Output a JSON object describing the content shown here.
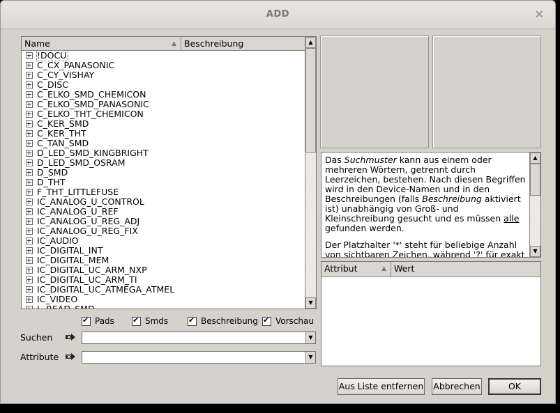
{
  "window": {
    "title": "ADD",
    "close_icon": "✕"
  },
  "tree": {
    "col_name": "Name",
    "col_desc": "Beschreibung",
    "items": [
      "!DOCU",
      "C_CX_PANASONIC",
      "C_CY_VISHAY",
      "C_DISC",
      "C_ELKO_SMD_CHEMICON",
      "C_ELKO_SMD_PANASONIC",
      "C_ELKO_THT_CHEMICON",
      "C_KER_SMD",
      "C_KER_THT",
      "C_TAN_SMD",
      "D_LED_SMD_KINGBRIGHT",
      "D_LED_SMD_OSRAM",
      "D_SMD",
      "D_THT",
      "F_THT_LITTLEFUSE",
      "IC_ANALOG_U_CONTROL",
      "IC_ANALOG_U_REF",
      "IC_ANALOG_U_REG_ADJ",
      "IC_ANALOG_U_REG_FIX",
      "IC_AUDIO",
      "IC_DIGITAL_INT",
      "IC_DIGITAL_MEM",
      "IC_DIGITAL_UC_ARM_NXP",
      "IC_DIGITAL_UC_ARM_TI",
      "IC_DIGITAL_UC_ATMEGA_ATMEL",
      "IC_VIDEO",
      "L_READ_SMD"
    ]
  },
  "options": {
    "pads": "Pads",
    "smds": "Smds",
    "beschreibung": "Beschreibung",
    "vorschau": "Vorschau"
  },
  "search": {
    "label": "Suchen",
    "value": ""
  },
  "attribute": {
    "label": "Attribute",
    "value": ""
  },
  "description": {
    "p1_a": "Das ",
    "p1_em": "Suchmuster",
    "p1_b": " kann aus einem oder mehreren Wörtern, getrennt durch Leerzeichen, bestehen. Nach diesen Begriffen wird in den Device-Namen und in den Beschreibungen (falls ",
    "p1_em2": "Beschreibung",
    "p1_c": " aktiviert ist) unabhängig von Groß- und Kleinschreibung gesucht und es müssen ",
    "p1_u": "alle",
    "p1_d": " gefunden werden.",
    "p2": "Der Platzhalter '*' steht für beliebige Anzahl von sichtbaren Zeichen, während '?' für exakt eines dieser Zeichen steht."
  },
  "attr_table": {
    "col_attr": "Attribut",
    "col_value": "Wert"
  },
  "buttons": {
    "remove": "Aus Liste entfernen",
    "cancel": "Abbrechen",
    "ok": "OK"
  }
}
